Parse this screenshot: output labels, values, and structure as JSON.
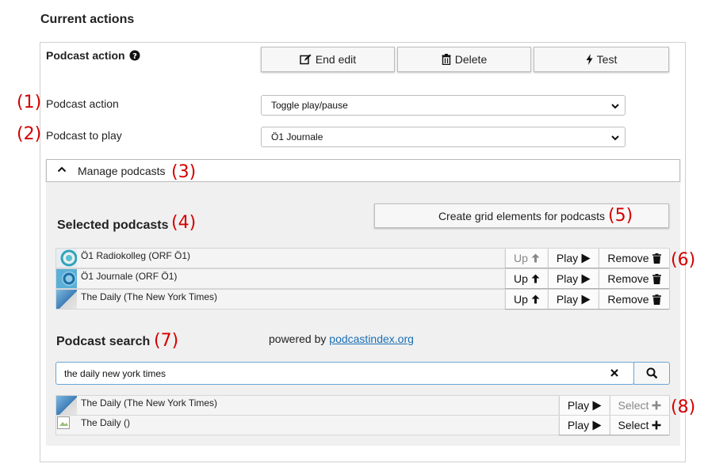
{
  "heading": "Current actions",
  "panel": {
    "title": "Podcast action",
    "help_icon": "question-circle-icon",
    "buttons": {
      "end_edit": "End edit",
      "delete": "Delete",
      "test": "Test"
    },
    "action_label": "Podcast action",
    "action_value": "Toggle play/pause",
    "podcast_label": "Podcast to play",
    "podcast_value": "Ö1 Journale",
    "manage_label": "Manage podcasts"
  },
  "manage": {
    "selected_title": "Selected podcasts",
    "create_button": "Create grid elements for podcasts",
    "selected": [
      {
        "title": "Ö1 Radiokolleg (ORF Ö1)",
        "up": "Up",
        "up_disabled": true,
        "play": "Play",
        "remove": "Remove"
      },
      {
        "title": "Ö1 Journale (ORF Ö1)",
        "up": "Up",
        "up_disabled": false,
        "play": "Play",
        "remove": "Remove"
      },
      {
        "title": "The Daily (The New York Times)",
        "up": "Up",
        "up_disabled": false,
        "play": "Play",
        "remove": "Remove"
      }
    ],
    "search_title": "Podcast search",
    "powered_by": "powered by",
    "powered_link": "podcastindex.org",
    "search_value": "the daily new york times",
    "results": [
      {
        "title": "The Daily (The New York Times)",
        "play": "Play",
        "select": "Select",
        "select_disabled": true
      },
      {
        "title": "The Daily ()",
        "play": "Play",
        "select": "Select",
        "select_disabled": false
      }
    ]
  },
  "annotations": [
    "(1)",
    "(2)",
    "(3)",
    "(4)",
    "(5)",
    "(6)",
    "(7)",
    "(8)"
  ],
  "colors": {
    "annotation": "#d40000",
    "link": "#1a6fb5",
    "search_border": "#6aa6d6"
  }
}
